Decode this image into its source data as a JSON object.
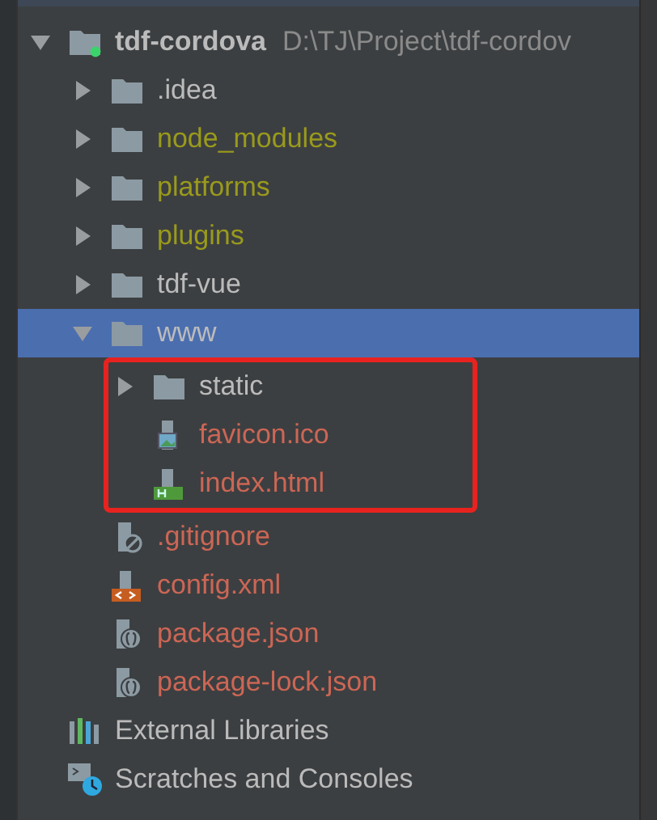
{
  "project_tree": {
    "root": {
      "label": "tdf-cordova",
      "path": "D:\\TJ\\Project\\tdf-cordov",
      "expanded": true,
      "children": [
        {
          "label": ".idea",
          "kind": "folder",
          "expanded": false,
          "selected": false,
          "color": "#bbbbbb"
        },
        {
          "label": "node_modules",
          "kind": "folder",
          "expanded": false,
          "selected": false,
          "color": "#9a9a1c"
        },
        {
          "label": "platforms",
          "kind": "folder",
          "expanded": false,
          "selected": false,
          "color": "#9a9a1c"
        },
        {
          "label": "plugins",
          "kind": "folder",
          "expanded": false,
          "selected": false,
          "color": "#9a9a1c"
        },
        {
          "label": "tdf-vue",
          "kind": "folder",
          "expanded": false,
          "selected": false,
          "color": "#bbbbbb"
        },
        {
          "label": "www",
          "kind": "folder",
          "expanded": true,
          "selected": true,
          "highlighted": true,
          "color": "#bbbbbb",
          "children": [
            {
              "label": "static",
              "kind": "folder",
              "expanded": false,
              "selected": false,
              "color": "#bbbbbb"
            },
            {
              "label": "favicon.ico",
              "kind": "image",
              "selected": false,
              "color": "#cc6655"
            },
            {
              "label": "index.html",
              "kind": "html",
              "selected": false,
              "color": "#cc6655"
            }
          ]
        },
        {
          "label": ".gitignore",
          "kind": "ignore",
          "selected": false,
          "color": "#cc6655"
        },
        {
          "label": "config.xml",
          "kind": "xml",
          "selected": false,
          "color": "#cc6655"
        },
        {
          "label": "package.json",
          "kind": "json",
          "selected": false,
          "color": "#cc6655"
        },
        {
          "label": "package-lock.json",
          "kind": "json",
          "selected": false,
          "color": "#cc6655"
        }
      ]
    },
    "extras": [
      {
        "label": "External Libraries",
        "kind": "libraries"
      },
      {
        "label": "Scratches and Consoles",
        "kind": "scratches"
      }
    ]
  }
}
